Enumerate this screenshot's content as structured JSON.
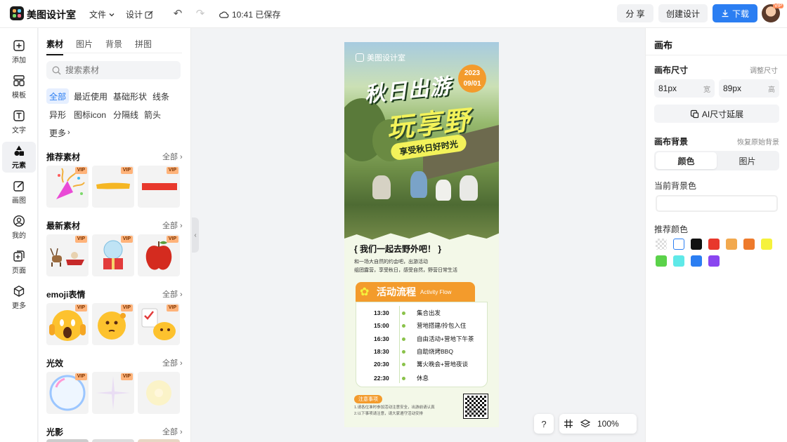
{
  "app": {
    "name": "美图设计室"
  },
  "topbar": {
    "file_menu": "文件",
    "design_menu": "设计",
    "save_status": "10:41 已保存",
    "share": "分 享",
    "create_design": "创建设计",
    "download": "下载",
    "avatar_badge": "VIP"
  },
  "leftnav": [
    {
      "label": "添加",
      "icon": "plus-square-icon"
    },
    {
      "label": "模板",
      "icon": "template-icon"
    },
    {
      "label": "文字",
      "icon": "text-icon"
    },
    {
      "label": "元素",
      "icon": "shapes-icon"
    },
    {
      "label": "画图",
      "icon": "draw-icon"
    },
    {
      "label": "我的",
      "icon": "user-icon"
    },
    {
      "label": "页面",
      "icon": "page-add-icon"
    },
    {
      "label": "更多",
      "icon": "cube-icon"
    }
  ],
  "panel": {
    "tabs": [
      "素材",
      "图片",
      "背景",
      "拼图"
    ],
    "search_placeholder": "搜索素材",
    "chips": [
      "全部",
      "最近使用",
      "基础形状",
      "线条",
      "异形",
      "图标icon",
      "分隔线",
      "箭头",
      "更多"
    ],
    "vip_label": "VIP",
    "sections": [
      {
        "title": "推荐素材",
        "all": "全部"
      },
      {
        "title": "最新素材",
        "all": "全部"
      },
      {
        "title": "emoji表情",
        "all": "全部"
      },
      {
        "title": "光效",
        "all": "全部"
      },
      {
        "title": "光影",
        "all": "全部"
      }
    ]
  },
  "poster": {
    "brand": "美图设计室",
    "title_line1": "秋日出游",
    "title_line2": "玩享野",
    "year": "2023",
    "date": "09/01",
    "banner": "享受秋日好时光",
    "slogan": "{ 我们一起去野外吧！ }",
    "intro_line1": "和一场大自然的约会吧，出游活动",
    "intro_line2": "组团露营，享受秋日，感受自然，野营日常生活",
    "flow_title": "活动流程",
    "flow_subtitle": "Activity Flow",
    "schedule": [
      {
        "time": "13:30",
        "item": "集合出发"
      },
      {
        "time": "15:00",
        "item": "营地搭建/拎包入住"
      },
      {
        "time": "16:30",
        "item": "自由活动+营地下午茶"
      },
      {
        "time": "18:30",
        "item": "自助烧烤BBQ"
      },
      {
        "time": "20:30",
        "item": "篝火晚会+营地夜谈"
      },
      {
        "time": "22:30",
        "item": "休息"
      }
    ],
    "note_label": "注意事项",
    "note_line1": "1.请各位准时参加活动注意安全，出游前请认真",
    "note_line2": "2.以下事项请注意，请大家遵守活动安排"
  },
  "zoom": {
    "level": "100%",
    "help": "?"
  },
  "rpanel": {
    "title": "画布",
    "size_label": "画布尺寸",
    "adjust_size": "调整尺寸",
    "width_value": "81px",
    "width_unit": "宽",
    "height_value": "89px",
    "height_unit": "高",
    "ai_extend": "AI尺寸延展",
    "bg_label": "画布背景",
    "restore_bg": "恢复原始背景",
    "seg_color": "颜色",
    "seg_image": "图片",
    "current_bg": "当前背景色",
    "recommended": "推荐颜色",
    "swatches": [
      "transparent",
      "#ffffff",
      "#111111",
      "#e8382c",
      "#f2a94e",
      "#ee7a2c",
      "#f5f23c",
      "#5bd24a",
      "#5fe9e8",
      "#2b7ef2",
      "#8a46f0"
    ]
  }
}
